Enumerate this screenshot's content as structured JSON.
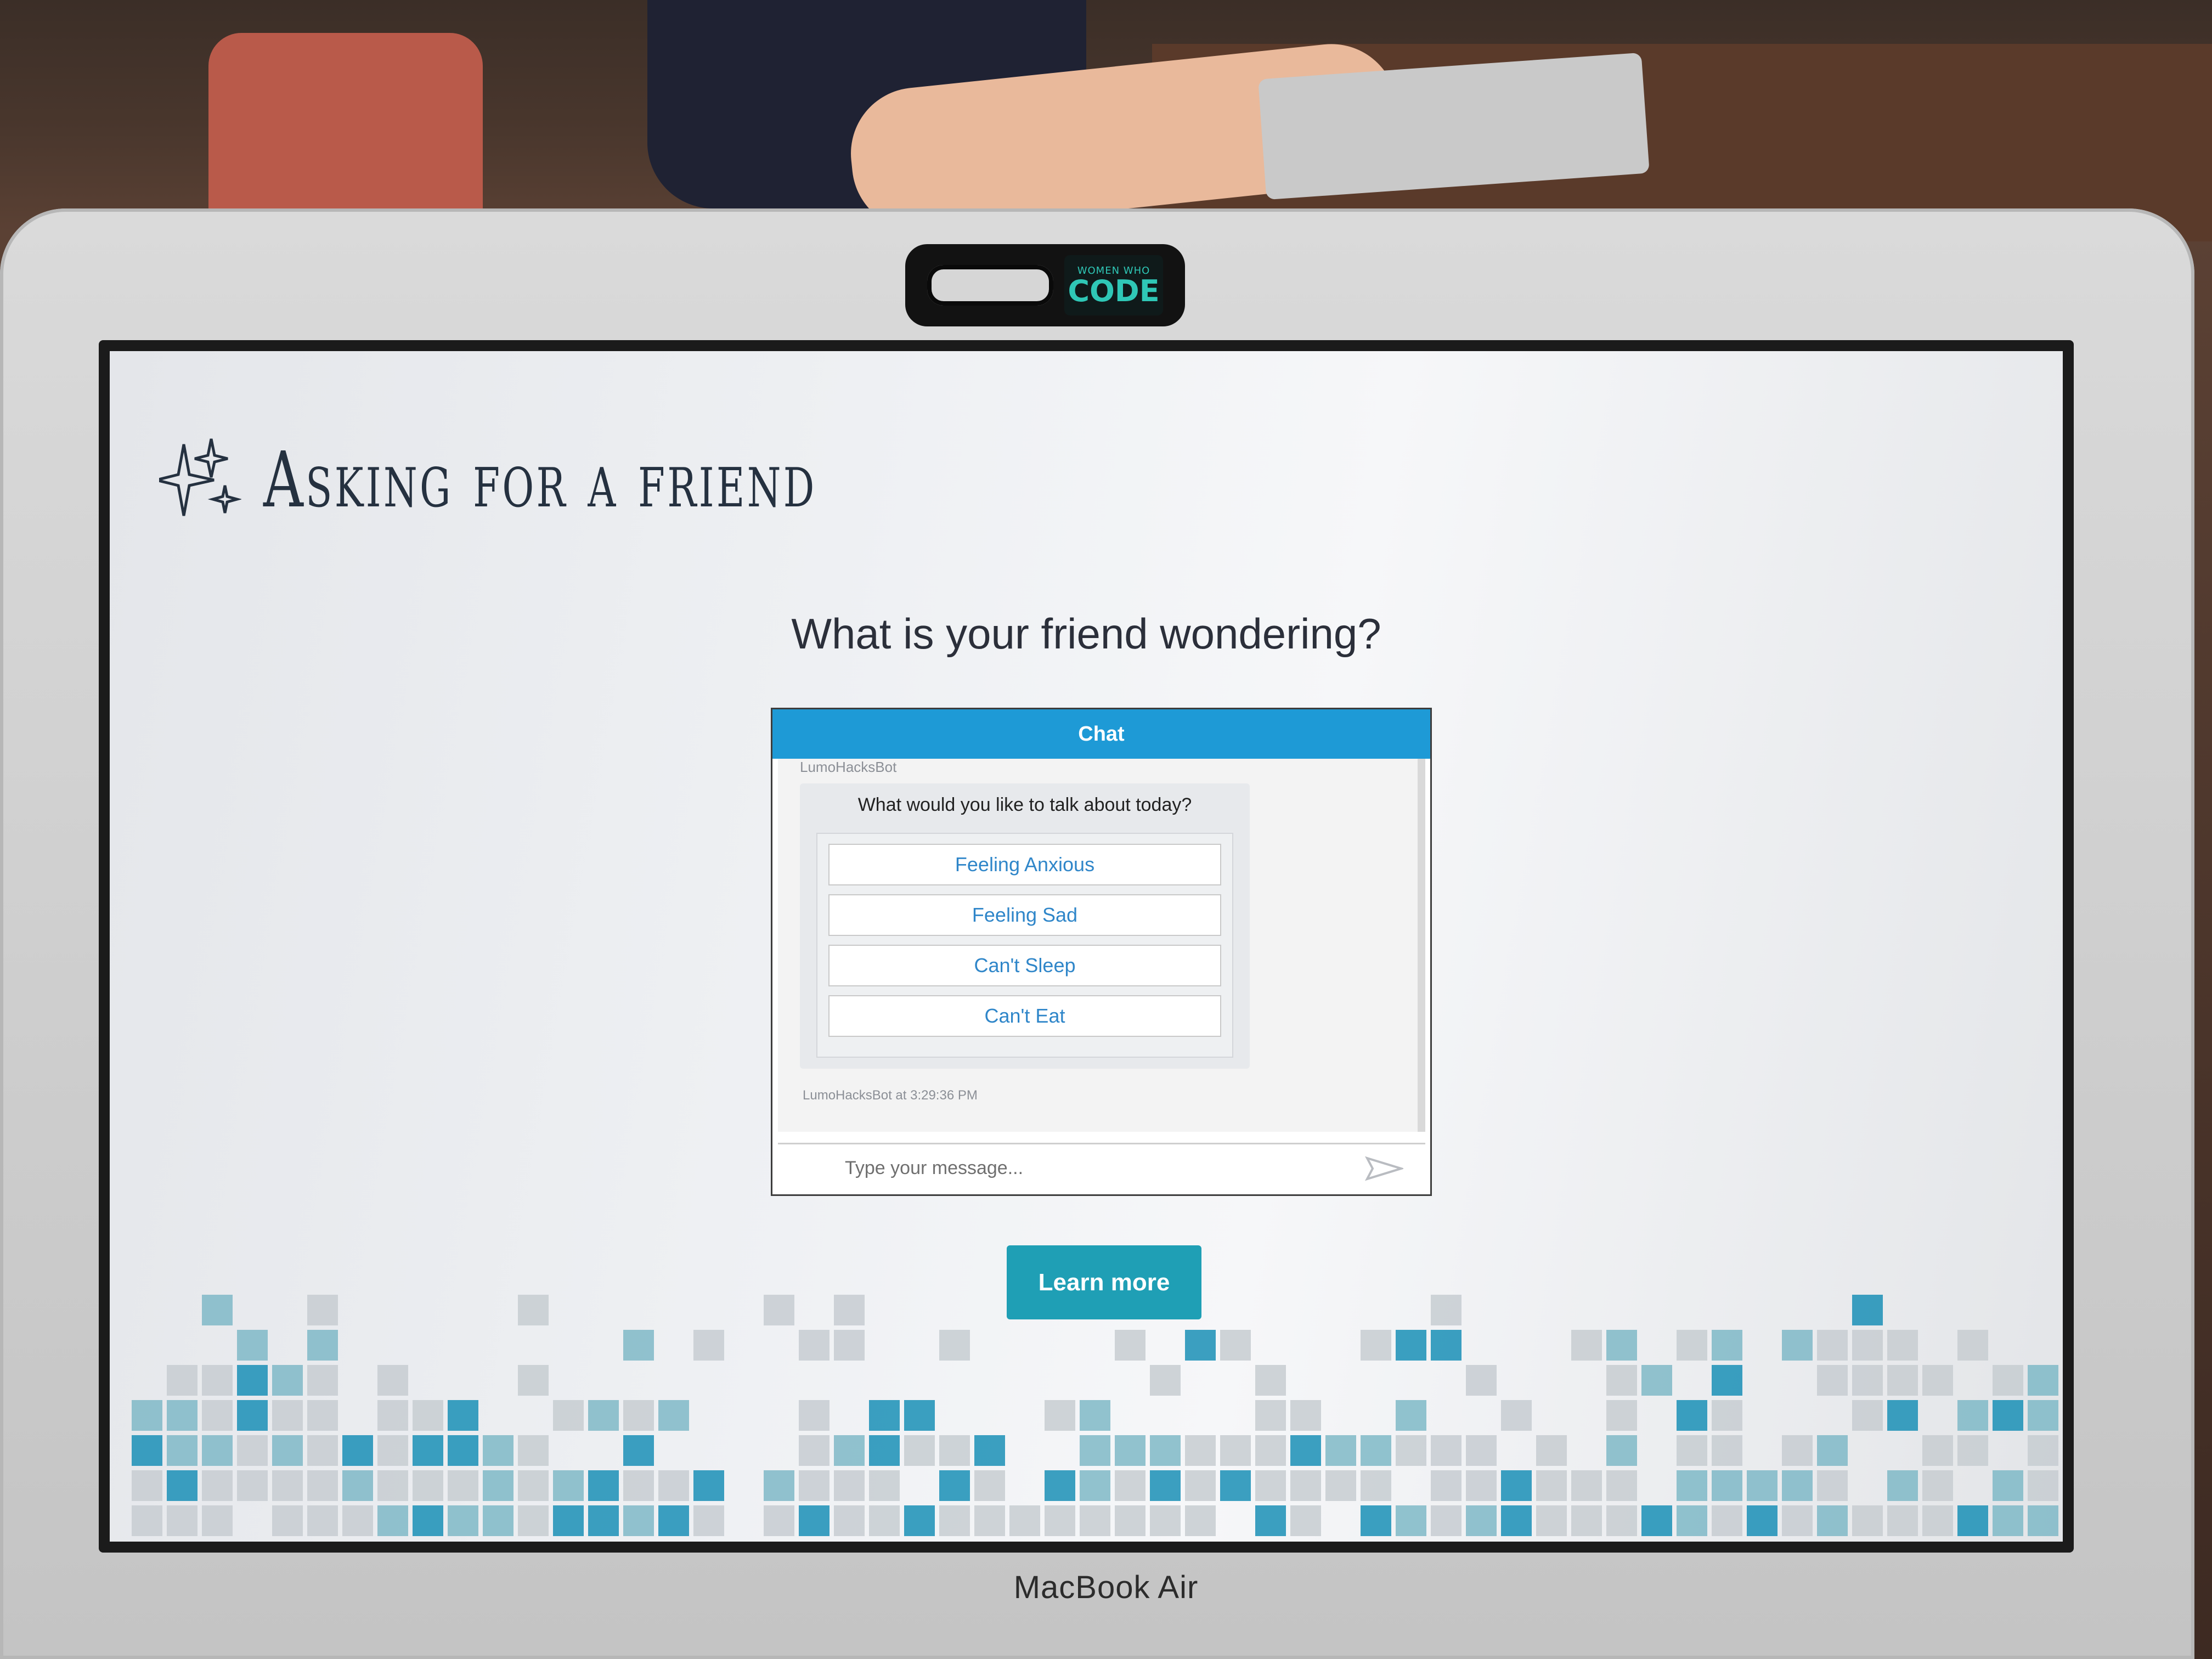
{
  "hardware": {
    "brand": "MacBook Air",
    "webcam_cover_small": "WOMEN WHO",
    "webcam_cover_big": "CODE"
  },
  "page": {
    "logo_text": "Asking for a friend",
    "question": "What is your friend wondering?",
    "learn_more_label": "Learn more"
  },
  "chat": {
    "header": "Chat",
    "sender": "LumoHacksBot",
    "prompt": "What would you like to talk about today?",
    "options": [
      "Feeling Anxious",
      "Feeling Sad",
      "Can't Sleep",
      "Can't Eat"
    ],
    "timestamp": "LumoHacksBot at 3:29:36 PM",
    "input_placeholder": "Type your message..."
  },
  "colors": {
    "chat_header": "#1e9ad6",
    "button": "#1f9fb5",
    "option_text": "#2f86c9",
    "mosaic_dark": "#1a8fb6",
    "mosaic_light": "#c7ccd1"
  }
}
